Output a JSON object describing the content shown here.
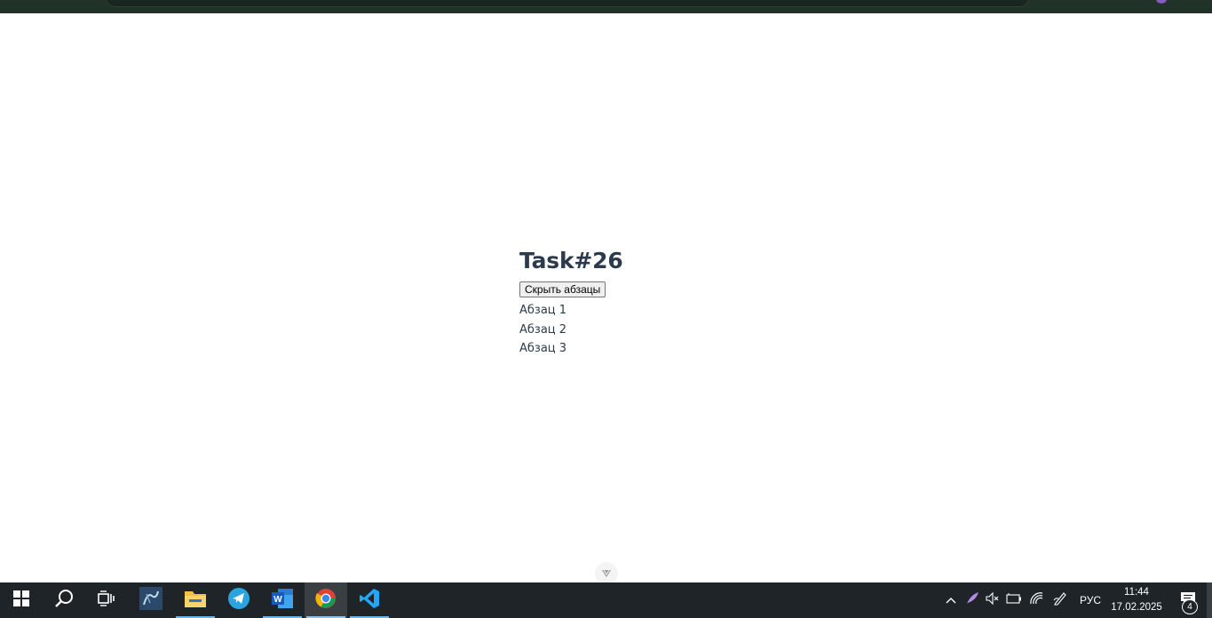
{
  "page": {
    "title": "Task#26",
    "button_label": "Скрыть абзацы",
    "paragraphs": [
      "Абзац 1",
      "Абзац 2",
      "Абзац 3"
    ]
  },
  "taskbar": {
    "apps": [
      {
        "name": "start-icon"
      },
      {
        "name": "search-icon"
      },
      {
        "name": "task-view-icon"
      },
      {
        "name": "mysql-workbench-icon"
      },
      {
        "name": "file-explorer-icon"
      },
      {
        "name": "telegram-icon"
      },
      {
        "name": "word-icon"
      },
      {
        "name": "chrome-icon"
      },
      {
        "name": "vscode-icon"
      }
    ],
    "tray": {
      "language": "РУС",
      "time": "11:44",
      "date": "17.02.2025",
      "notifications_count": "4"
    }
  }
}
